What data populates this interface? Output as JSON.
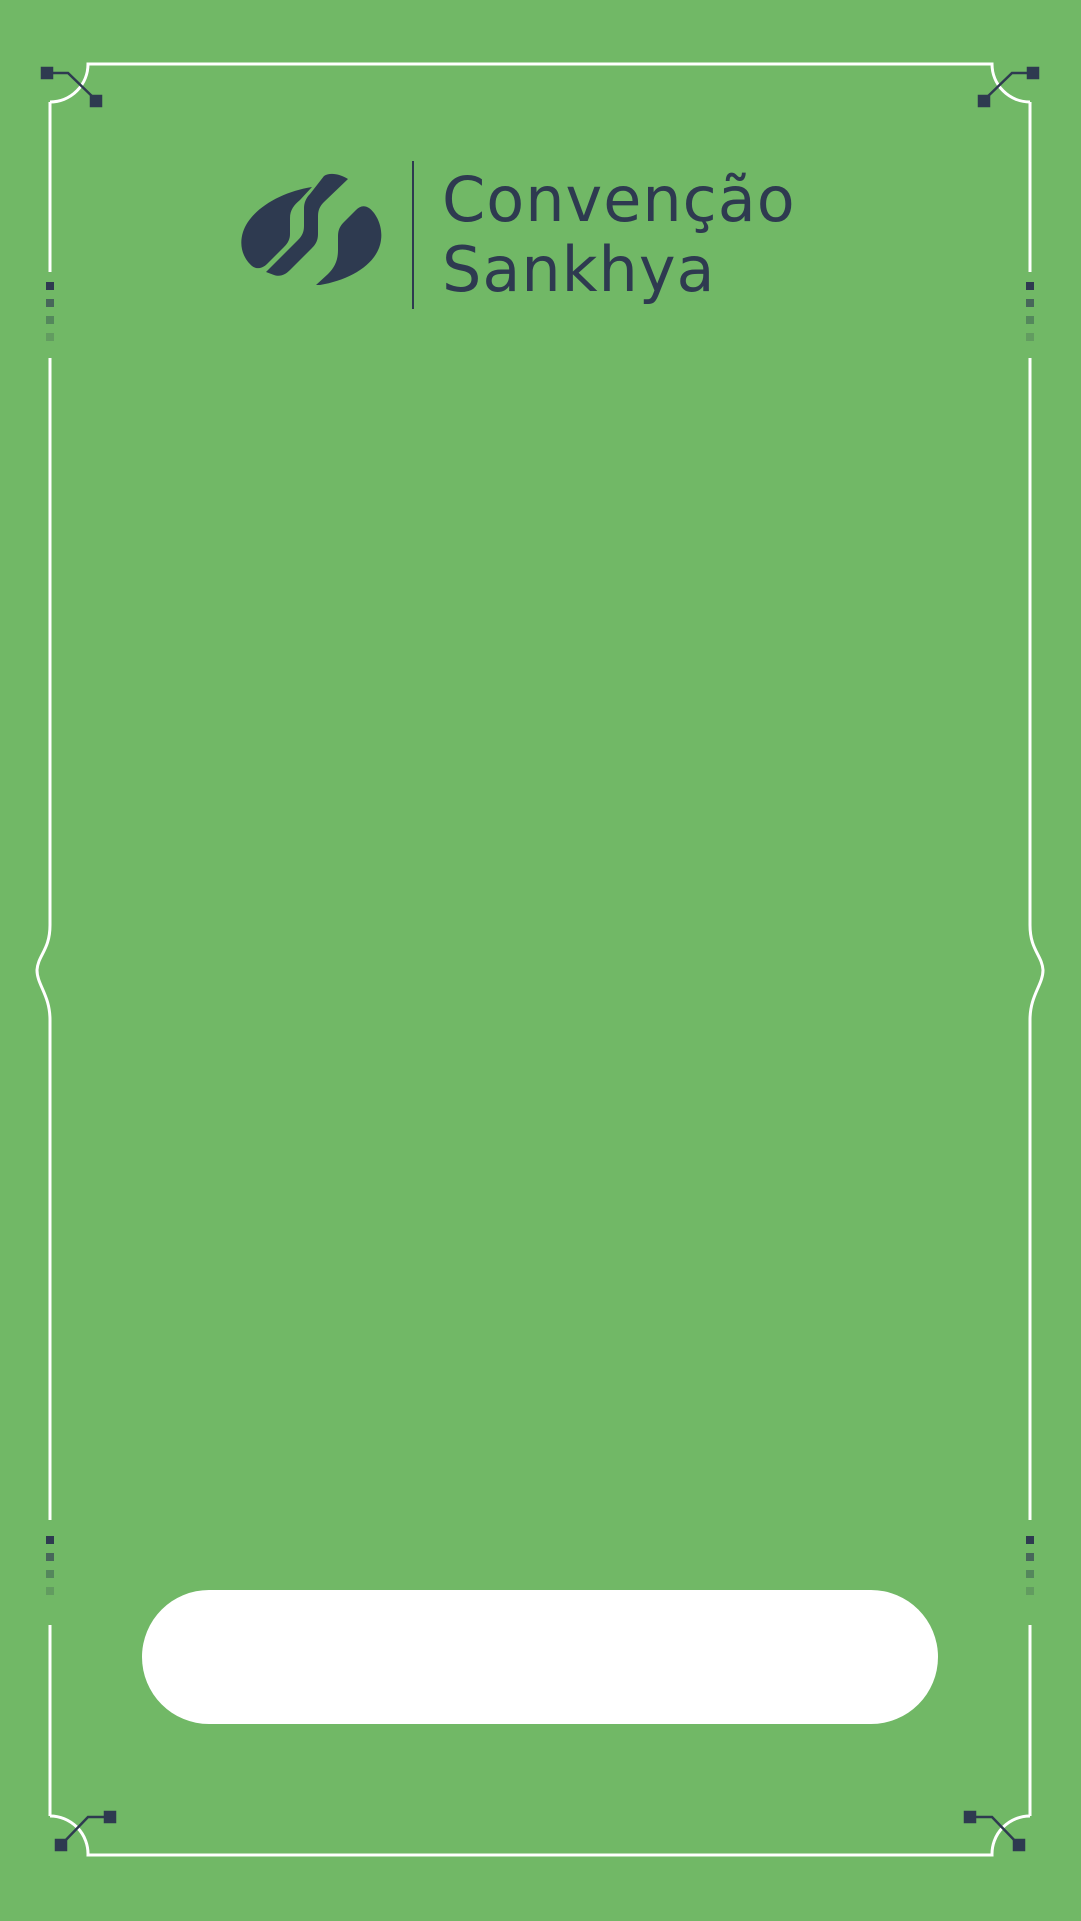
{
  "brand": {
    "logo_icon": "sankhya-leaf-icon",
    "title_line1": "Convenção",
    "title_line2": "Sankhya"
  },
  "colors": {
    "background": "#71b866",
    "ink": "#2e3a50",
    "frame": "#ffffff",
    "name_field": "#ffffff"
  },
  "name_field": {
    "value": ""
  }
}
